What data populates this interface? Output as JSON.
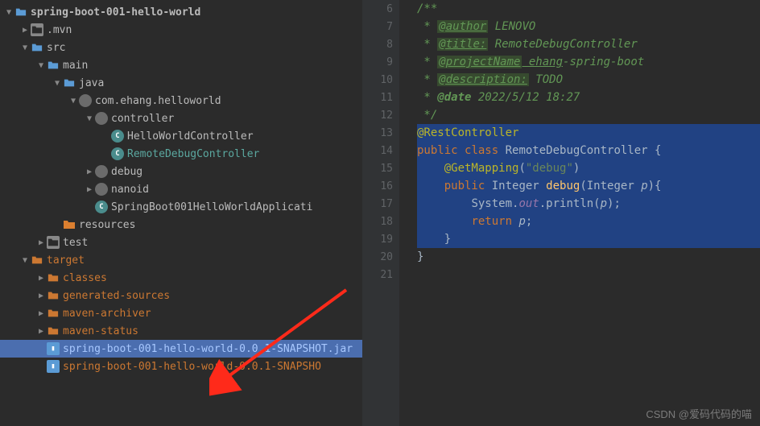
{
  "tree": {
    "root": "spring-boot-001-hello-world",
    "items": [
      {
        "indent": 1,
        "chev": "▶",
        "icon": "folder",
        "label": ".mvn"
      },
      {
        "indent": 1,
        "chev": "▼",
        "icon": "folder-b",
        "label": "src"
      },
      {
        "indent": 2,
        "chev": "▼",
        "icon": "folder-b",
        "label": "main"
      },
      {
        "indent": 3,
        "chev": "▼",
        "icon": "folder-b",
        "label": "java"
      },
      {
        "indent": 4,
        "chev": "▼",
        "icon": "pkg",
        "label": "com.ehang.helloworld"
      },
      {
        "indent": 5,
        "chev": "▼",
        "icon": "pkg",
        "label": "controller"
      },
      {
        "indent": 6,
        "chev": "",
        "icon": "class",
        "label": "HelloWorldController"
      },
      {
        "indent": 6,
        "chev": "",
        "icon": "class",
        "label": "RemoteDebugController",
        "hl": "teal"
      },
      {
        "indent": 5,
        "chev": "▶",
        "icon": "pkg",
        "label": "debug"
      },
      {
        "indent": 5,
        "chev": "▶",
        "icon": "pkg",
        "label": "nanoid"
      },
      {
        "indent": 5,
        "chev": "",
        "icon": "class",
        "label": "SpringBoot001HelloWorldApplicati"
      },
      {
        "indent": 3,
        "chev": "",
        "icon": "res",
        "label": "resources",
        "hl": ""
      },
      {
        "indent": 2,
        "chev": "▶",
        "icon": "folder",
        "label": "test"
      },
      {
        "indent": 1,
        "chev": "▼",
        "icon": "folder-y",
        "label": "target",
        "hl": "orange"
      },
      {
        "indent": 2,
        "chev": "▶",
        "icon": "folder-y",
        "label": "classes",
        "hl": "orange"
      },
      {
        "indent": 2,
        "chev": "▶",
        "icon": "folder-y",
        "label": "generated-sources",
        "hl": "orange"
      },
      {
        "indent": 2,
        "chev": "▶",
        "icon": "folder-y",
        "label": "maven-archiver",
        "hl": "orange"
      },
      {
        "indent": 2,
        "chev": "▶",
        "icon": "folder-y",
        "label": "maven-status",
        "hl": "orange"
      },
      {
        "indent": 2,
        "chev": "",
        "icon": "jar",
        "label": "spring-boot-001-hello-world-0.0.1-SNAPSHOT.jar",
        "hl": "blue",
        "selected": true
      },
      {
        "indent": 2,
        "chev": "",
        "icon": "jar",
        "label": "spring-boot-001-hello-world-0.0.1-SNAPSHO",
        "hl": "orange"
      }
    ]
  },
  "gutter": {
    "start": 6,
    "lines": [
      "6",
      "7",
      "8",
      "9",
      "10",
      "11",
      "12",
      "13",
      "14",
      "15",
      "16",
      "17",
      "18",
      "19",
      "20",
      "21"
    ],
    "markers": {
      "14": "green",
      "16": "green",
      "17": "red"
    }
  },
  "code": {
    "l6": "/**",
    "l7_pre": " * ",
    "l7_tag": "@author",
    "l7_txt": " LENOVO",
    "l8_pre": " * ",
    "l8_tag": "@title:",
    "l8_txt": " RemoteDebugController",
    "l9_pre": " * ",
    "l9_tag": "@projectName",
    "l9_txt": " ehang",
    "l9_txt2": "-spring-boot",
    "l10_pre": " * ",
    "l10_tag": "@description:",
    "l10_txt": " TODO",
    "l11_pre": " * ",
    "l11_tag": "@date",
    "l11_txt": " 2022/5/12 18:27",
    "l12": " */",
    "l13": "@RestController",
    "l14_kw1": "public ",
    "l14_kw2": "class ",
    "l14_cls": "RemoteDebugController ",
    "l14_br": "{",
    "l15_ind": "    ",
    "l15_ann": "@GetMapping",
    "l15_p1": "(",
    "l15_str": "\"debug\"",
    "l15_p2": ")",
    "l16_ind": "    ",
    "l16_kw": "public ",
    "l16_type": "Integer ",
    "l16_m": "debug",
    "l16_p1": "(Integer ",
    "l16_par": "p",
    "l16_p2": "){",
    "l17_ind": "        ",
    "l17_sys": "System.",
    "l17_out": "out",
    "l17_pr": ".println(",
    "l17_par": "p",
    "l17_end": ");",
    "l18_ind": "        ",
    "l18_kw": "return ",
    "l18_par": "p",
    "l18_end": ";",
    "l19": "    }",
    "l20": "}"
  },
  "watermark": "CSDN @爱码代码的喵"
}
